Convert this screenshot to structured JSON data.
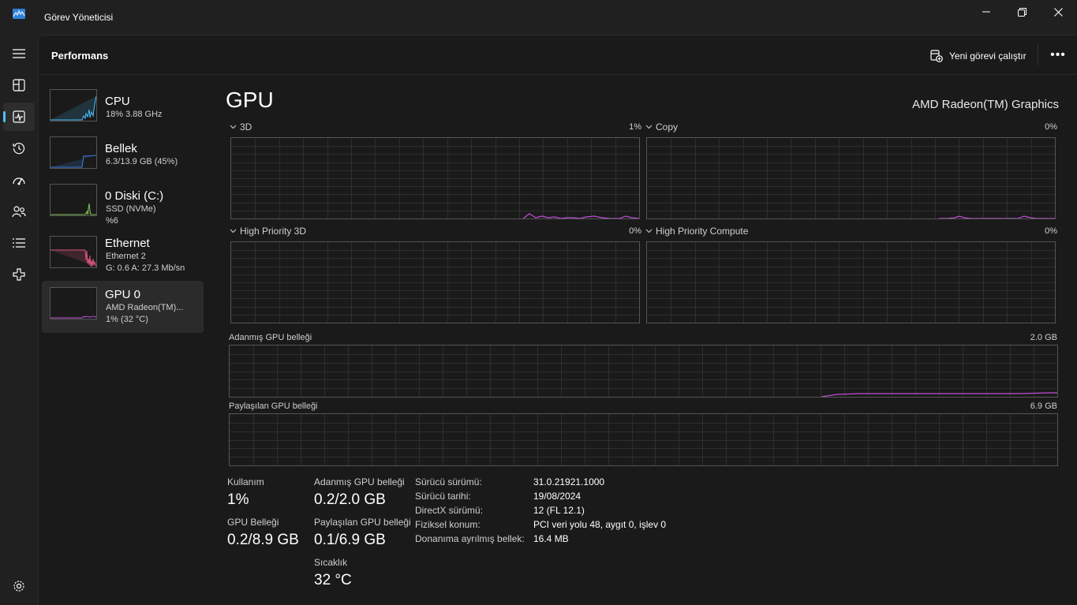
{
  "window": {
    "title": "Görev Yöneticisi"
  },
  "header": {
    "title": "Performans",
    "run_task_label": "Yeni görevi çalıştır",
    "more_label": "•••"
  },
  "devices": [
    {
      "name": "CPU",
      "line1": "18%  3.88 GHz",
      "line2": "",
      "color": "#4cc2ff",
      "selected": false
    },
    {
      "name": "Bellek",
      "line1": "6.3/13.9 GB (45%)",
      "line2": "",
      "color": "#3d7bd9",
      "selected": false
    },
    {
      "name": "0 Diski (C:)",
      "line1": "SSD (NVMe)",
      "line2": "%6",
      "color": "#7fc04a",
      "selected": false
    },
    {
      "name": "Ethernet",
      "line1": "Ethernet 2",
      "line2": "G: 0.6  A: 27.3 Mb/sn",
      "color": "#d8577a",
      "selected": false
    },
    {
      "name": "GPU 0",
      "line1": "AMD Radeon(TM)...",
      "line2": "1%  (32 °C)",
      "color": "#c04fd6",
      "selected": true
    }
  ],
  "gpu": {
    "title": "GPU",
    "model": "AMD Radeon(TM) Graphics",
    "engines": [
      {
        "label": "3D",
        "percent": "1%"
      },
      {
        "label": "Copy",
        "percent": "0%"
      },
      {
        "label": "High Priority 3D",
        "percent": "0%"
      },
      {
        "label": "High Priority Compute",
        "percent": "0%"
      }
    ],
    "dedicated_label": "Adanmış GPU belleği",
    "dedicated_max": "2.0 GB",
    "shared_label": "Paylaşılan GPU belleği",
    "shared_max": "6.9 GB"
  },
  "stats": {
    "usage_label": "Kullanım",
    "usage_value": "1%",
    "gpu_mem_label": "GPU Belleği",
    "gpu_mem_value": "0.2/8.9 GB",
    "dedicated_label": "Adanmış GPU belleği",
    "dedicated_value": "0.2/2.0 GB",
    "shared_label": "Paylaşılan GPU belleği",
    "shared_value": "0.1/6.9 GB",
    "temp_label": "Sıcaklık",
    "temp_value": "32 °C"
  },
  "info": [
    {
      "key": "Sürücü sürümü:",
      "value": "31.0.21921.1000"
    },
    {
      "key": "Sürücü tarihi:",
      "value": "19/08/2024"
    },
    {
      "key": "DirectX sürümü:",
      "value": "12 (FL 12.1)"
    },
    {
      "key": "Fiziksel konum:",
      "value": "PCI veri yolu 48, aygıt 0, işlev 0"
    },
    {
      "key": "Donanıma ayrılmış bellek:",
      "value": "16.4 MB"
    }
  ],
  "colors": {
    "gpu_line": "#c04fd6",
    "accent": "#4cc2ff",
    "grid": "#2e2e2e",
    "border": "#555555"
  },
  "icons": {
    "nav": [
      "hamburger-icon",
      "processes-icon",
      "performance-icon",
      "app-history-icon",
      "startup-apps-icon",
      "users-icon",
      "details-icon",
      "services-icon",
      "settings-icon"
    ]
  }
}
